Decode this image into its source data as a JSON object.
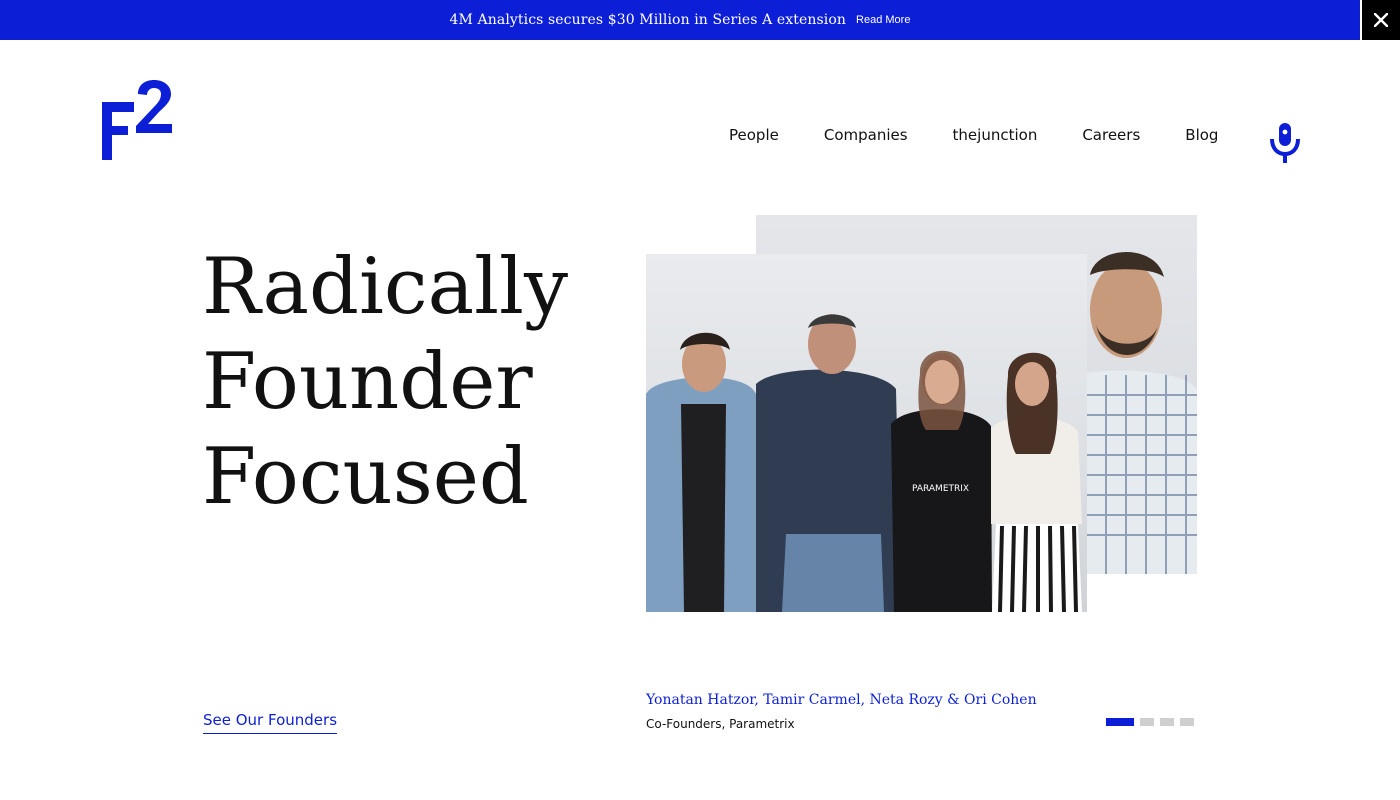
{
  "announcement": {
    "message": "4M Analytics secures $30 Million in Series A extension",
    "link_label": "Read More",
    "close_icon": "close-icon"
  },
  "header": {
    "logo_icon": "f2-logo",
    "nav": [
      {
        "label": "People"
      },
      {
        "label": "Companies"
      },
      {
        "label": "thejunction"
      },
      {
        "label": "Careers"
      },
      {
        "label": "Blog"
      }
    ],
    "podcast_icon": "microphone-icon"
  },
  "hero": {
    "headline": [
      "Radically",
      "Founder",
      "Focused"
    ],
    "cta_label": "See Our Founders",
    "slide": {
      "names": "Yonatan Hatzor, Tamir Carmel, Neta Rozy & Ori Cohen",
      "role": "Co-Founders, Parametrix"
    },
    "slides_total": 4,
    "slides_active": 1
  },
  "colors": {
    "brand_blue": "#0c1fd6",
    "text": "#111111",
    "inactive_dot": "#cfcfcf"
  }
}
